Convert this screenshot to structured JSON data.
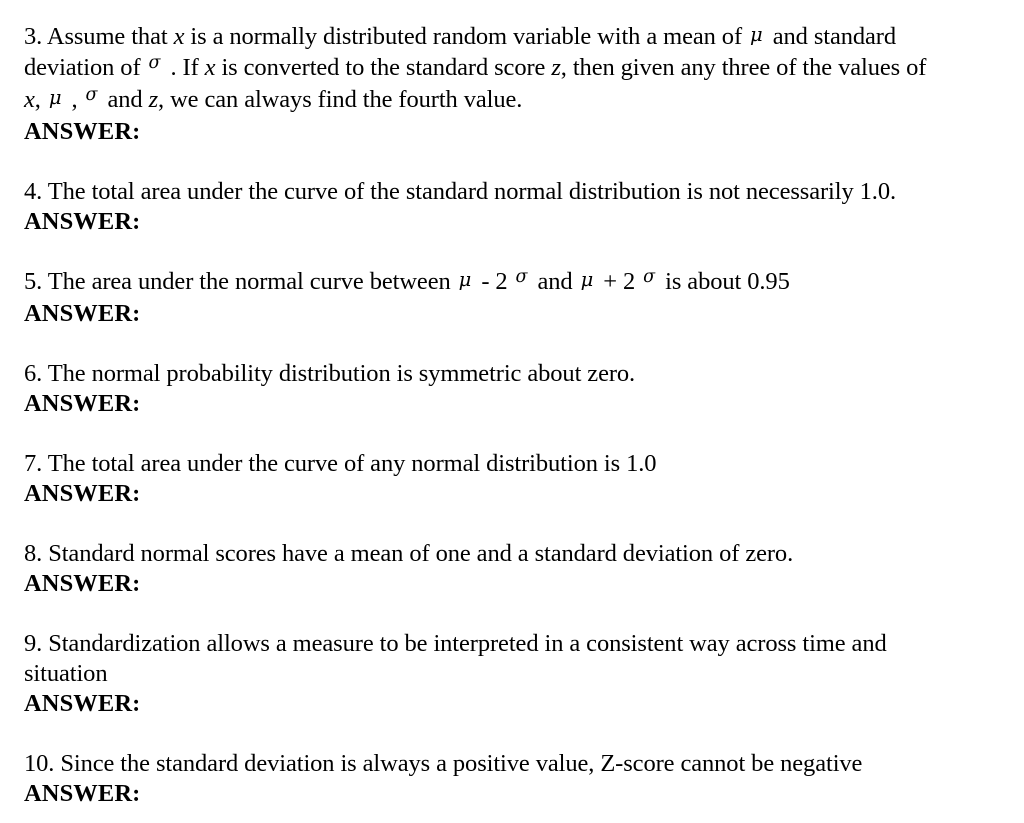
{
  "document": {
    "background_color": "#ffffff",
    "text_color": "#000000",
    "answer_label": "ANSWER:",
    "symbols": {
      "mu": "μ",
      "sigma": "σ"
    },
    "items": [
      {
        "number": "3.",
        "answer_label": "ANSWER:",
        "segments": [
          {
            "type": "text",
            "value": "3. Assume that "
          },
          {
            "type": "var",
            "value": "x"
          },
          {
            "type": "text",
            "value": " is a normally distributed random variable with a mean of"
          },
          {
            "type": "mu",
            "value": "μ"
          },
          {
            "type": "text",
            "value": "and standard deviation of"
          },
          {
            "type": "sigma",
            "value": "σ"
          },
          {
            "type": "text",
            "value": ". If "
          },
          {
            "type": "var",
            "value": "x"
          },
          {
            "type": "text",
            "value": " is converted to the standard score "
          },
          {
            "type": "var",
            "value": "z"
          },
          {
            "type": "text",
            "value": ", then given any three of the values of "
          },
          {
            "type": "var",
            "value": "x"
          },
          {
            "type": "text",
            "value": ","
          },
          {
            "type": "mu",
            "value": "μ"
          },
          {
            "type": "text",
            "value": ","
          },
          {
            "type": "sigma",
            "value": "σ"
          },
          {
            "type": "text",
            "value": "and "
          },
          {
            "type": "var",
            "value": "z"
          },
          {
            "type": "text",
            "value": ", we can always find the fourth value."
          }
        ]
      },
      {
        "number": "4.",
        "answer_label": "ANSWER:",
        "segments": [
          {
            "type": "text",
            "value": "4. The total area under the curve of the standard normal distribution is not necessarily 1.0."
          }
        ]
      },
      {
        "number": "5.",
        "answer_label": "ANSWER:",
        "segments": [
          {
            "type": "text",
            "value": "5. The area under the normal curve between"
          },
          {
            "type": "mu",
            "value": "μ"
          },
          {
            "type": "text",
            "value": "- 2"
          },
          {
            "type": "sigma",
            "value": "σ"
          },
          {
            "type": "text",
            "value": "and"
          },
          {
            "type": "mu",
            "value": "μ"
          },
          {
            "type": "text",
            "value": "+ 2"
          },
          {
            "type": "sigma",
            "value": "σ"
          },
          {
            "type": "text",
            "value": "is about 0.95"
          }
        ]
      },
      {
        "number": "6.",
        "answer_label": "ANSWER:",
        "segments": [
          {
            "type": "text",
            "value": "6. The normal probability distribution is symmetric about zero."
          }
        ]
      },
      {
        "number": "7.",
        "answer_label": "ANSWER:",
        "segments": [
          {
            "type": "text",
            "value": "7. The total area under the curve of any normal distribution is 1.0"
          }
        ]
      },
      {
        "number": "8.",
        "answer_label": "ANSWER:",
        "segments": [
          {
            "type": "text",
            "value": "8. Standard normal scores have a mean of one and a standard deviation of zero."
          }
        ]
      },
      {
        "number": "9.",
        "answer_label": "ANSWER:",
        "segments": [
          {
            "type": "text",
            "value": "9. Standardization allows a measure to be interpreted in a consistent way across time and situation"
          }
        ]
      },
      {
        "number": "10.",
        "answer_label": "ANSWER:",
        "segments": [
          {
            "type": "text",
            "value": "10. Since the standard deviation is always a positive value, Z-score cannot be negative"
          }
        ]
      }
    ]
  }
}
